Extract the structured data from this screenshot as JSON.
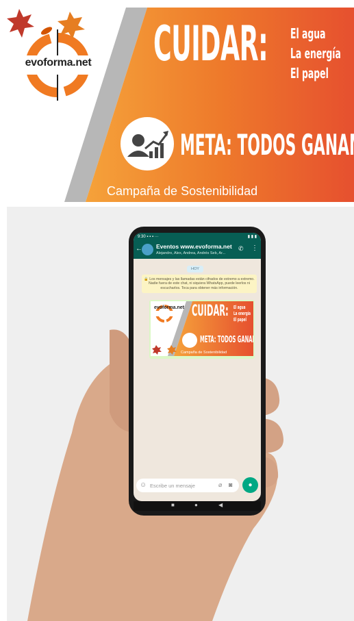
{
  "banner": {
    "logo_text": "evoforma.net",
    "headline": "CUIDAR:",
    "items": [
      "El agua",
      "La energía",
      "El papel"
    ],
    "goal": "META: TODOS GANAMOS!",
    "campaign": "Campaña de Sostenibilidad",
    "colors": {
      "orange": "#f08a24",
      "red": "#e8502e",
      "gray": "#b3b3b3"
    }
  },
  "phone": {
    "status_time": "9:30",
    "status_icons": "▪ ▪ ▪ ···",
    "status_right": "▮ ▮ ▮",
    "chat": {
      "back_icon": "←",
      "title": "Eventos www.evoforma.net",
      "members": "Alejandro, Alex, Andrea, Andrés Seb, Ar...",
      "call_icon": "phone-add-icon",
      "menu_icon": "more-vertical-icon",
      "date_chip": "HOY",
      "encryption_notice": "🔒 Los mensajes y las llamadas están cifrados de extremo a extremo. Nadie fuera de este chat, ni siquiera WhatsApp, puede leerlos ni escucharlos. Toca para obtener más información.",
      "image_message": {
        "logo_text": "evoforma.net",
        "headline": "CUIDAR:",
        "items": [
          "El agua",
          "La energía",
          "El papel"
        ],
        "goal": "META: TODOS GANAMOS!",
        "campaign": "Campaña de Sostenibilidad"
      },
      "input_placeholder": "Escribe un mensaje",
      "accent": "#075e54",
      "mic_color": "#00a884"
    },
    "nav": {
      "left": "■",
      "center": "●",
      "right": "◀"
    }
  }
}
